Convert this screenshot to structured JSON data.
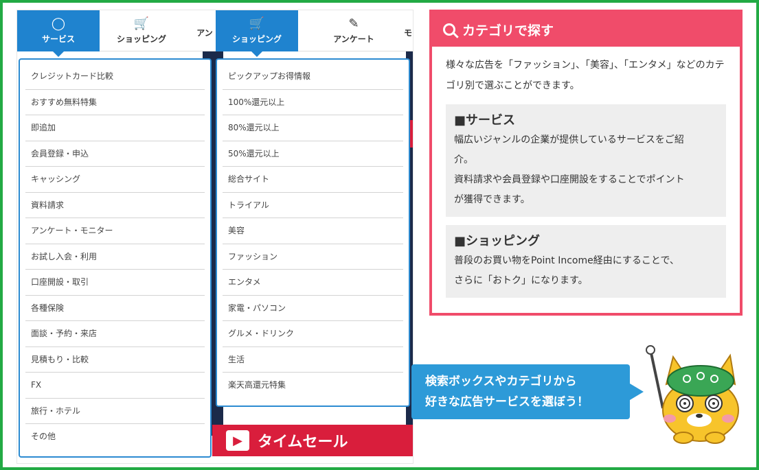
{
  "tabs_left": [
    {
      "label": "サービス",
      "icon": "lightbulb-icon",
      "active": true
    },
    {
      "label": "ショッピング",
      "icon": "cart-icon",
      "active": false
    },
    {
      "label": "アン",
      "icon": "",
      "active": false
    }
  ],
  "tabs_right": [
    {
      "label": "ショッピング",
      "icon": "cart-icon",
      "active": true
    },
    {
      "label": "アンケート",
      "icon": "survey-icon",
      "active": false
    },
    {
      "label": "モ",
      "icon": "",
      "active": false
    }
  ],
  "service_menu": [
    "クレジットカード比較",
    "おすすめ無料特集",
    "即追加",
    "会員登録・申込",
    "キャッシング",
    "資料請求",
    "アンケート・モニター",
    "お試し入会・利用",
    "口座開設・取引",
    "各種保険",
    "面談・予約・来店",
    "見積もり・比較",
    "FX",
    "旅行・ホテル",
    "その他"
  ],
  "shopping_menu": [
    "ピックアップお得情報",
    "100%還元以上",
    "80%還元以上",
    "50%還元以上",
    "総合サイト",
    "トライアル",
    "美容",
    "ファッション",
    "エンタメ",
    "家電・パソコン",
    "グルメ・ドリンク",
    "生活",
    "楽天高還元特集"
  ],
  "banner": {
    "label": "タイムセール"
  },
  "panel": {
    "title": "カテゴリで探す",
    "intro": "様々な広告を「ファッション」、「美容」、「エンタメ」などのカテゴリ別で選ぶことができます。",
    "sections": [
      {
        "title": "■サービス",
        "body_lines": [
          "幅広いジャンルの企業が提供しているサービスをご紹",
          "介。",
          "資料請求や会員登録や口座開設をすることでポイント",
          "が獲得できます。"
        ]
      },
      {
        "title": "■ショッピング",
        "body_lines": [
          "普段のお買い物をPoint Income経由にすることで、",
          "さらに「おトク」になります。"
        ]
      }
    ]
  },
  "bubble": {
    "line1": "検索ボックスやカテゴリから",
    "line2": "好きな広告サービスを選ぼう！"
  },
  "colors": {
    "accent_blue": "#1f83cf",
    "panel_pink": "#f04c6a",
    "frame_green": "#22aa44",
    "banner_red": "#d91e3c"
  }
}
